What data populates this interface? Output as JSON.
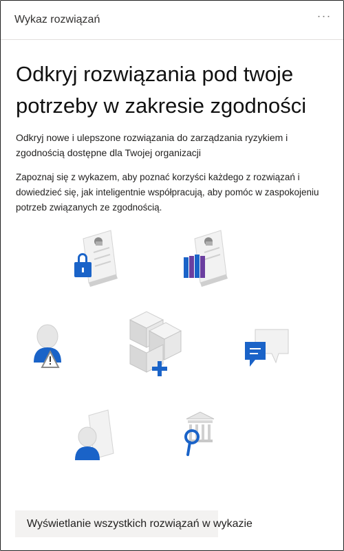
{
  "card": {
    "title": "Wykaz rozwiązań",
    "more_label": "···"
  },
  "hero": {
    "heading": "Odkryj rozwiązania pod twoje potrzeby w zakresie zgodności"
  },
  "content": {
    "intro": "Odkryj nowe i ulepszone rozwiązania do zarządzania ryzykiem i zgodnością dostępne dla Twojej organizacji",
    "detail": "Zapoznaj się z wykazem, aby poznać korzyści każdego z rozwiązań i dowiedzieć się, jak inteligentnie współpracują, aby pomóc w zaspokojeniu potrzeb związanych ze zgodnością."
  },
  "illustration": {
    "icons": [
      "lock-document-icon",
      "archive-document-icon",
      "user-warning-icon",
      "cubes-add-icon",
      "chat-bubbles-icon",
      "user-document-icon",
      "building-search-icon"
    ],
    "colors": {
      "accent": "#1a63c8",
      "purple": "#6b3fa0",
      "light_gray": "#e6e6e6",
      "mid_gray": "#c8c8c8",
      "dark_gray": "#8a8a8a"
    }
  },
  "footer": {
    "cta_label": "Wyświetlanie wszystkich rozwiązań w wykazie"
  }
}
